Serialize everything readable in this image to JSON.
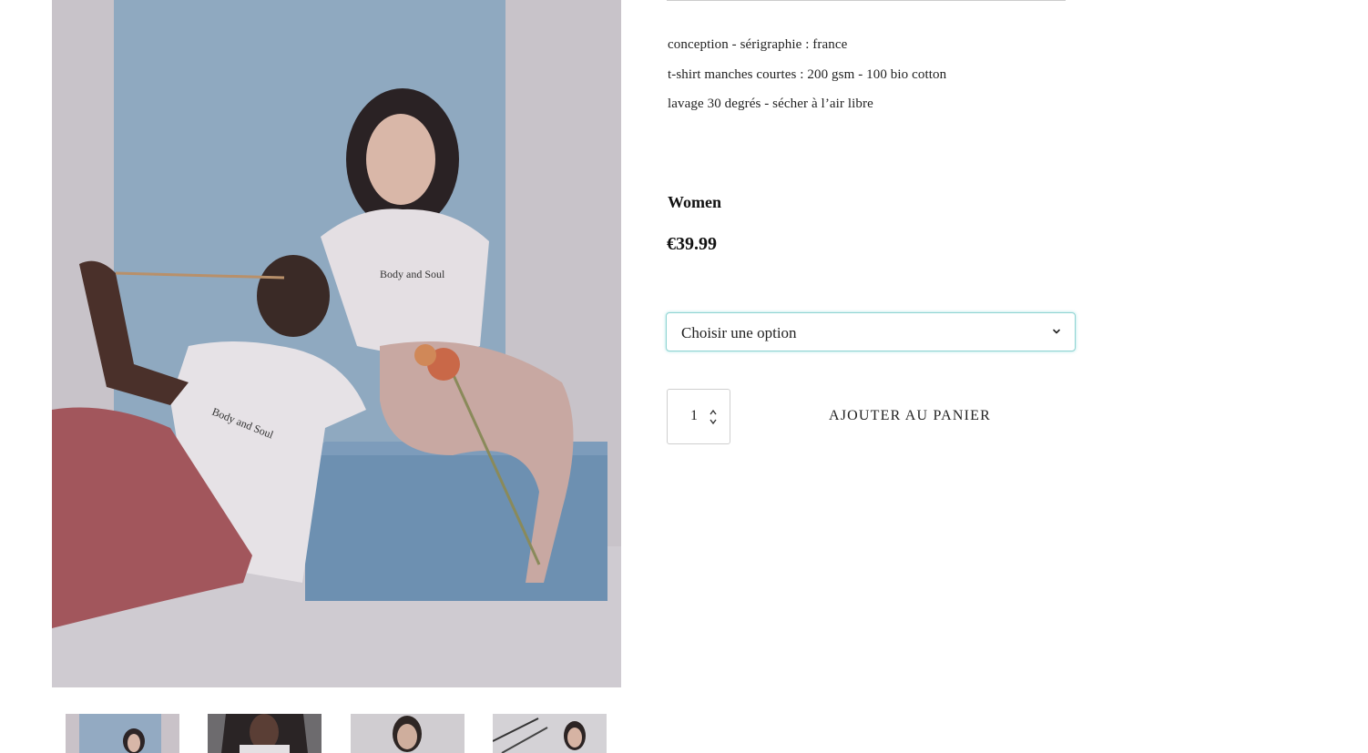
{
  "product": {
    "description_lines": [
      "conception - sérigraphie : france",
      "t-shirt manches courtes : 200 gsm - 100 bio cotton",
      "lavage 30 degrés - sécher à l’air libre"
    ],
    "category": "Women",
    "price": "€39.99",
    "variation_select": {
      "selected": "Choisir une option",
      "icon": "chevron-down-icon"
    },
    "quantity": "1",
    "add_to_cart_label": "AJOUTER AU PANIER"
  },
  "gallery": {
    "main_image_alt": "Body and Soul",
    "thumbnails": [
      "thumb-1",
      "thumb-2",
      "thumb-3",
      "thumb-4"
    ]
  },
  "colors": {
    "select_border": "#8fd4d2",
    "backdrop_blue": "#8fa8bf",
    "box_blue": "#6f91b3",
    "wall": "#c6c1c7",
    "pants_red": "#a2555b"
  }
}
